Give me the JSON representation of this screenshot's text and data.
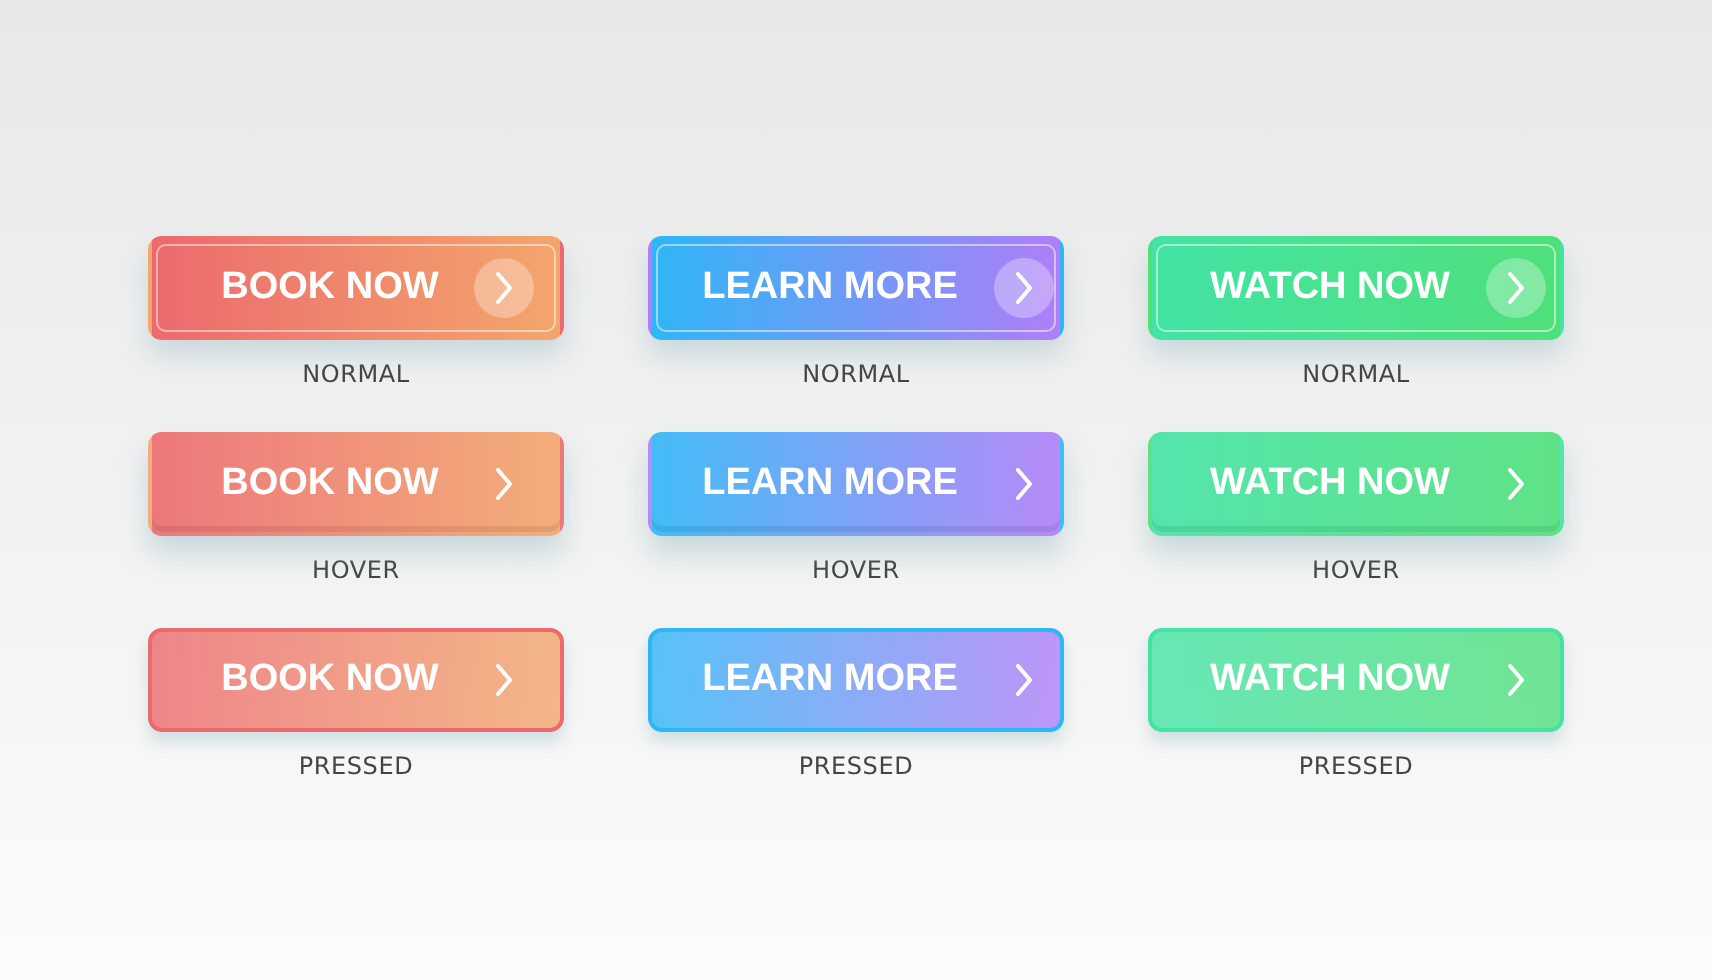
{
  "rows": [
    {
      "kind": "normal",
      "buttons": [
        {
          "label": "BOOK NOW",
          "kind": "coral",
          "caption": "NORMAL"
        },
        {
          "label": "LEARN MORE",
          "kind": "blue",
          "caption": "NORMAL"
        },
        {
          "label": "WATCH NOW",
          "kind": "green",
          "caption": "NORMAL"
        }
      ]
    },
    {
      "kind": "hover",
      "buttons": [
        {
          "label": "BOOK NOW",
          "kind": "coral",
          "caption": "HOVER"
        },
        {
          "label": "LEARN MORE",
          "kind": "blue",
          "caption": "HOVER"
        },
        {
          "label": "WATCH NOW",
          "kind": "green",
          "caption": "HOVER"
        }
      ]
    },
    {
      "kind": "pressed",
      "buttons": [
        {
          "label": "BOOK NOW",
          "kind": "coral",
          "caption": "PRESSED"
        },
        {
          "label": "LEARN MORE",
          "kind": "blue",
          "caption": "PRESSED"
        },
        {
          "label": "WATCH NOW",
          "kind": "green",
          "caption": "PRESSED"
        }
      ]
    }
  ]
}
